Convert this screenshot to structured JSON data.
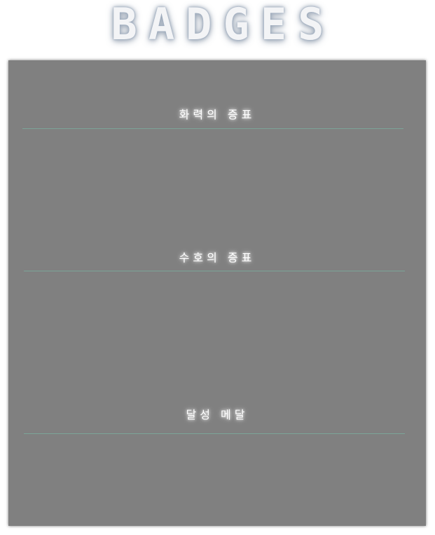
{
  "page": {
    "title": "BADGES"
  },
  "sections": [
    {
      "title": "화력의 증표"
    },
    {
      "title": "수호의 증표"
    },
    {
      "title": "달성 메달"
    }
  ],
  "colors": {
    "panel_background": "#808080",
    "divider": "#7aa89a",
    "section_text": "#ffffff",
    "title_text": "#f3f4f6"
  }
}
